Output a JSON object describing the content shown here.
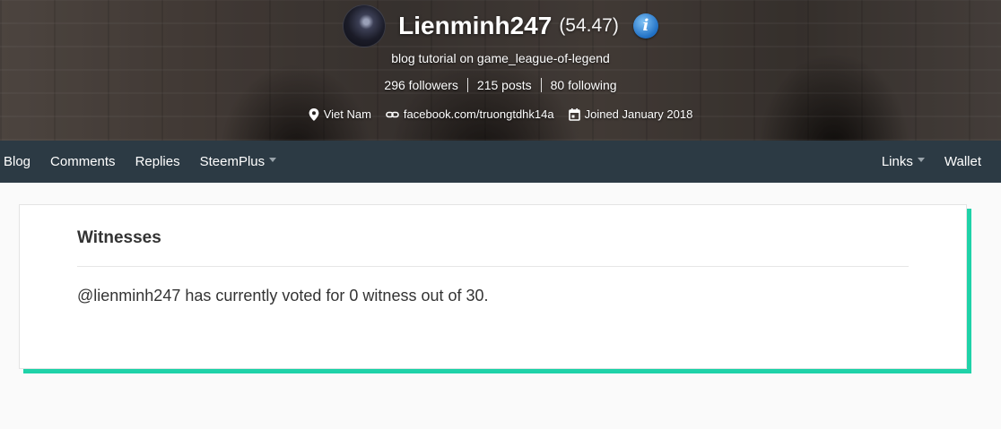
{
  "profile": {
    "username": "Lienminh247",
    "reputation": "(54.47)",
    "info_icon_glyph": "i",
    "about": "blog tutorial on game_league-of-legend",
    "stats": {
      "followers": "296 followers",
      "posts": "215 posts",
      "following": "80 following"
    },
    "location": "Viet Nam",
    "website": "facebook.com/truongtdhk14a",
    "joined": "Joined January 2018"
  },
  "icons": {
    "info": "info-icon",
    "location": "map-pin-icon",
    "website": "link-icon",
    "joined": "calendar-icon"
  },
  "nav": {
    "left": [
      "Blog",
      "Comments",
      "Replies",
      "SteemPlus"
    ],
    "right": [
      "Links",
      "Wallet"
    ]
  },
  "witness_card": {
    "title": "Witnesses",
    "message": "@lienminh247 has currently voted for 0 witness out of 30."
  },
  "colors": {
    "navbar": "#2c3a44",
    "accent": "#1fd2a8",
    "info_icon": "#1f6fc4"
  }
}
